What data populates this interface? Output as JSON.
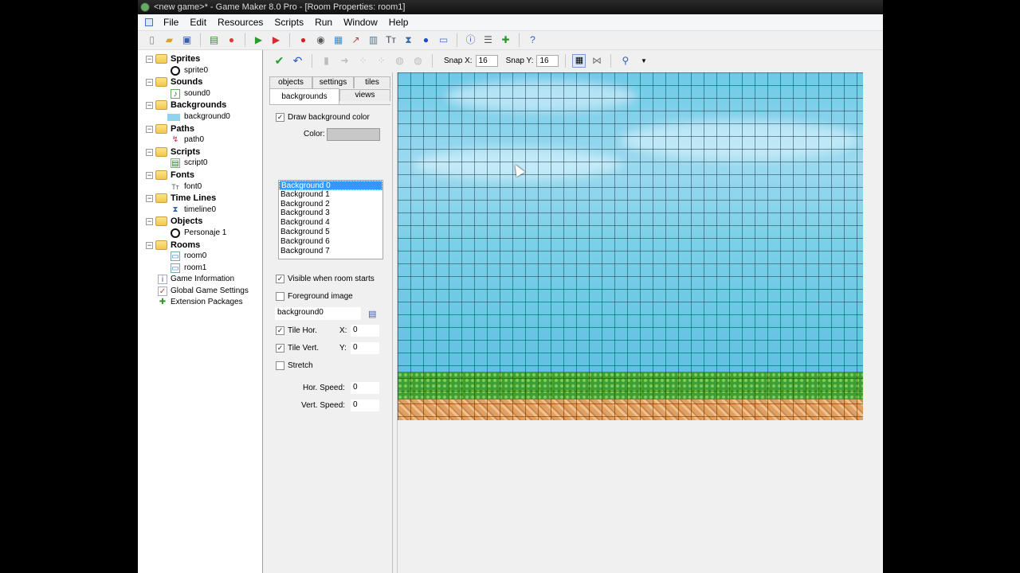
{
  "window": {
    "title": "<new game>* - Game Maker 8.0 Pro - [Room Properties: room1]"
  },
  "menu": [
    "File",
    "Edit",
    "Resources",
    "Scripts",
    "Run",
    "Window",
    "Help"
  ],
  "tree": {
    "groups": [
      {
        "label": "Sprites",
        "icon": "folder-icon",
        "items": [
          {
            "label": "sprite0",
            "icon": "sprite-icon"
          }
        ]
      },
      {
        "label": "Sounds",
        "icon": "folder-icon",
        "items": [
          {
            "label": "sound0",
            "icon": "sound-icon"
          }
        ]
      },
      {
        "label": "Backgrounds",
        "icon": "folder-icon",
        "items": [
          {
            "label": "background0",
            "icon": "background-icon"
          }
        ]
      },
      {
        "label": "Paths",
        "icon": "folder-icon",
        "items": [
          {
            "label": "path0",
            "icon": "path-icon"
          }
        ]
      },
      {
        "label": "Scripts",
        "icon": "folder-icon",
        "items": [
          {
            "label": "script0",
            "icon": "script-icon"
          }
        ]
      },
      {
        "label": "Fonts",
        "icon": "folder-icon",
        "items": [
          {
            "label": "font0",
            "icon": "font-icon"
          }
        ]
      },
      {
        "label": "Time Lines",
        "icon": "folder-icon",
        "items": [
          {
            "label": "timeline0",
            "icon": "timeline-icon"
          }
        ]
      },
      {
        "label": "Objects",
        "icon": "folder-icon",
        "items": [
          {
            "label": "Personaje 1",
            "icon": "object-icon"
          }
        ]
      },
      {
        "label": "Rooms",
        "icon": "folder-icon",
        "items": [
          {
            "label": "room0",
            "icon": "room-icon"
          },
          {
            "label": "room1",
            "icon": "room-icon"
          }
        ]
      }
    ],
    "extras": [
      {
        "label": "Game Information",
        "icon": "info-icon"
      },
      {
        "label": "Global Game Settings",
        "icon": "settings-icon"
      },
      {
        "label": "Extension Packages",
        "icon": "extension-icon"
      }
    ]
  },
  "room": {
    "snap_x_label": "Snap X:",
    "snap_x": "16",
    "snap_y_label": "Snap Y:",
    "snap_y": "16",
    "tabs": [
      "objects",
      "settings",
      "tiles",
      "backgrounds",
      "views"
    ],
    "active_tab": "backgrounds",
    "draw_bg_color_label": "Draw background color",
    "draw_bg_color": true,
    "color_label": "Color:",
    "color_value": "#c8c8c8",
    "backgrounds": [
      "Background 0",
      "Background 1",
      "Background 2",
      "Background 3",
      "Background 4",
      "Background 5",
      "Background 6",
      "Background 7"
    ],
    "selected_background": "Background 0",
    "visible_label": "Visible when room starts",
    "visible": true,
    "foreground_label": "Foreground image",
    "foreground": false,
    "background_resource": "background0",
    "tile_hor_label": "Tile Hor.",
    "tile_hor": true,
    "tile_vert_label": "Tile Vert.",
    "tile_vert": true,
    "x_label": "X:",
    "x_value": "0",
    "y_label": "Y:",
    "y_value": "0",
    "stretch_label": "Stretch",
    "stretch": false,
    "hor_speed_label": "Hor. Speed:",
    "hor_speed": "0",
    "vert_speed_label": "Vert. Speed:",
    "vert_speed": "0"
  }
}
